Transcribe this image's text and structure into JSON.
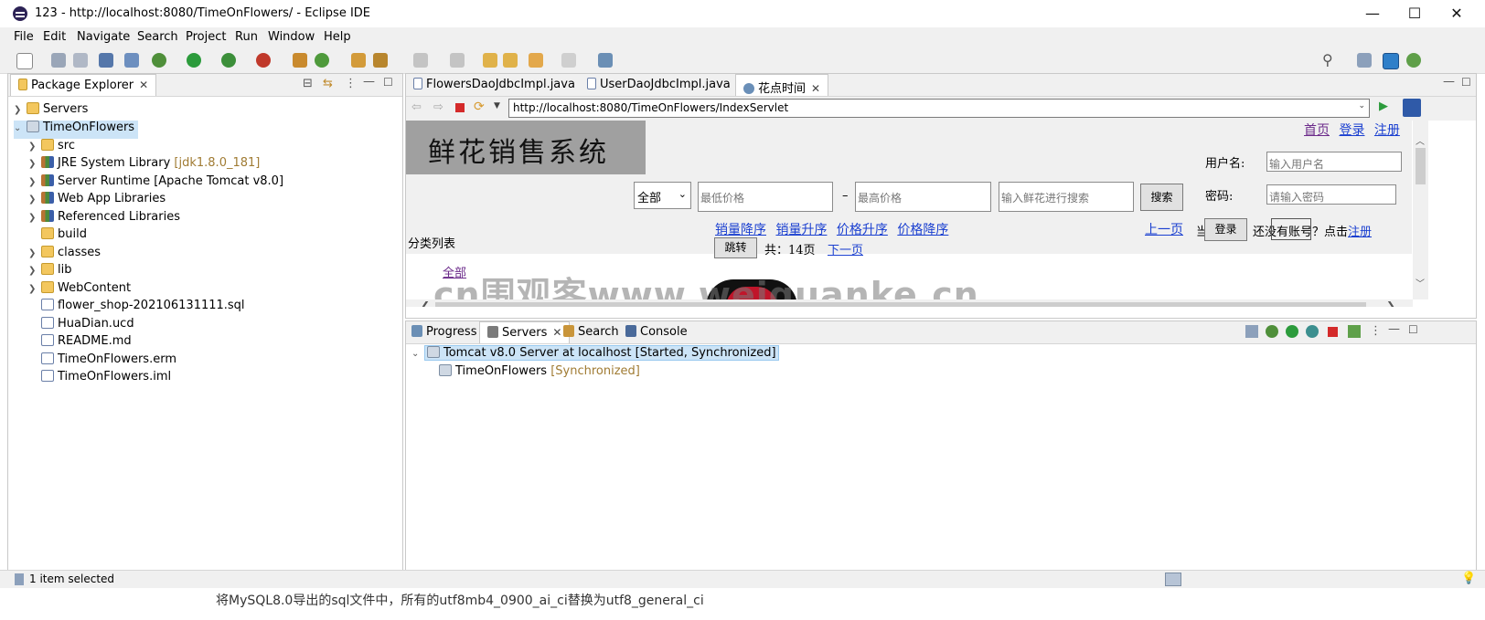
{
  "window": {
    "title": "123 - http://localhost:8080/TimeOnFlowers/ - Eclipse IDE"
  },
  "menu": [
    "File",
    "Edit",
    "Navigate",
    "Search",
    "Project",
    "Run",
    "Window",
    "Help"
  ],
  "package_explorer": {
    "tab_label": "Package Explorer",
    "tree": [
      {
        "label": "Servers",
        "deco": ""
      },
      {
        "label": "TimeOnFlowers",
        "deco": ""
      },
      {
        "label": "src",
        "deco": ""
      },
      {
        "label": "JRE System Library",
        "deco": "[jdk1.8.0_181]"
      },
      {
        "label": "Server Runtime [Apache Tomcat v8.0]",
        "deco": ""
      },
      {
        "label": "Web App Libraries",
        "deco": ""
      },
      {
        "label": "Referenced Libraries",
        "deco": ""
      },
      {
        "label": "build",
        "deco": ""
      },
      {
        "label": "classes",
        "deco": ""
      },
      {
        "label": "lib",
        "deco": ""
      },
      {
        "label": "WebContent",
        "deco": ""
      },
      {
        "label": "flower_shop-202106131111.sql",
        "deco": ""
      },
      {
        "label": "HuaDian.ucd",
        "deco": ""
      },
      {
        "label": "README.md",
        "deco": ""
      },
      {
        "label": "TimeOnFlowers.erm",
        "deco": ""
      },
      {
        "label": "TimeOnFlowers.iml",
        "deco": ""
      }
    ]
  },
  "editor": {
    "tabs": [
      "FlowersDaoJdbcImpl.java",
      "UserDaoJdbcImpl.java",
      "花点时间"
    ],
    "url": "http://localhost:8080/TimeOnFlowers/IndexServlet"
  },
  "page": {
    "logo_text": "鲜花销售系统",
    "top_links": [
      "首页",
      "登录",
      "注册"
    ],
    "username_label": "用户名:",
    "username_placeholder": "输入用户名",
    "password_label": "密码:",
    "password_placeholder": "请输入密码",
    "category_select": "全部",
    "min_price_placeholder": "最低价格",
    "dash": "–",
    "max_price_placeholder": "最高价格",
    "keyword_placeholder": "输入鲜花进行搜索",
    "search_button": "搜索",
    "sort_links": [
      "销量降序",
      "销量升序",
      "价格升序",
      "价格降序"
    ],
    "prev_page": "上一页",
    "page_fragment": "当",
    "login_button": "登录",
    "no_account_text": "还没有账号？点击",
    "register_link": "注册",
    "category_heading": "分类列表",
    "jump_button": "跳转",
    "total_pages": "共：14页",
    "next_page": "下一页",
    "all_link": "全部",
    "watermark": "cn围观客www.weiguanke.cn"
  },
  "bottom": {
    "tabs": [
      "Progress",
      "Servers",
      "Search",
      "Console"
    ],
    "server_row": "Tomcat v8.0 Server at localhost  [Started, Synchronized]",
    "module_row": "TimeOnFlowers",
    "module_status": "[Synchronized]"
  },
  "status": {
    "text": "1 item selected"
  },
  "behind_text": "将MySQL8.0导出的sql文件中，所有的utf8mb4_0900_ai_ci替换为utf8_general_ci"
}
